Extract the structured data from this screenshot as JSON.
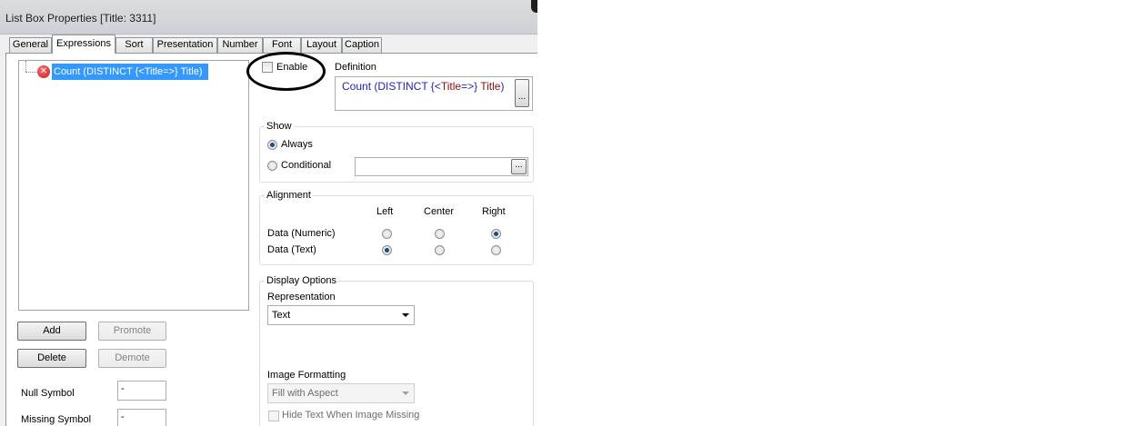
{
  "window": {
    "title": "List Box Properties [Title: 3311]"
  },
  "tabs": [
    {
      "label": "General"
    },
    {
      "label": "Expressions",
      "active": true
    },
    {
      "label": "Sort"
    },
    {
      "label": "Presentation"
    },
    {
      "label": "Number"
    },
    {
      "label": "Font"
    },
    {
      "label": "Layout"
    },
    {
      "label": "Caption"
    }
  ],
  "expressions": {
    "items": [
      {
        "label": "Count (DISTINCT {<Title=>} Title)",
        "status_icon": "error-icon",
        "selected": true
      }
    ],
    "buttons": {
      "add": "Add",
      "promote": "Promote",
      "delete": "Delete",
      "demote": "Demote"
    },
    "null_symbol": {
      "label": "Null Symbol",
      "value": "-"
    },
    "missing_symbol": {
      "label": "Missing Symbol",
      "value": "-"
    }
  },
  "enable": {
    "label": "Enable",
    "checked": false
  },
  "definition": {
    "label": "Definition",
    "text": "Count (DISTINCT {<Title=>} Title)",
    "tokens": {
      "func": "Count (DISTINCT {<",
      "field1": "Title",
      "mid": "=>} ",
      "field2": "Title",
      "end": ")"
    },
    "browse": "..."
  },
  "show": {
    "title": "Show",
    "always": "Always",
    "conditional": "Conditional",
    "selected": "Always",
    "condition_value": "",
    "browse": "..."
  },
  "alignment": {
    "title": "Alignment",
    "columns": [
      "Left",
      "Center",
      "Right"
    ],
    "rows": [
      {
        "label": "Data (Numeric)",
        "selected": "Right"
      },
      {
        "label": "Data (Text)",
        "selected": "Left"
      }
    ]
  },
  "display_options": {
    "title": "Display Options",
    "representation_label": "Representation",
    "representation_value": "Text",
    "image_formatting_label": "Image Formatting",
    "image_formatting_value": "Fill with Aspect",
    "hide_text_label": "Hide Text When Image Missing",
    "hide_text_checked": false
  },
  "colors": {
    "selection": "#3399ff",
    "annotation_circle": "#000000",
    "expression_function": "#1f1fbf",
    "expression_field": "#8b1010",
    "error_icon": "#c8201f"
  }
}
